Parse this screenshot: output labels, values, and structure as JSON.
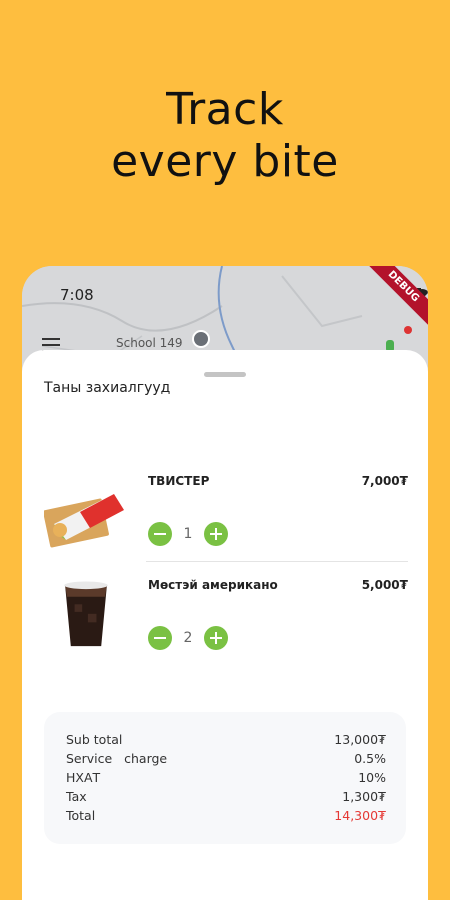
{
  "headline": {
    "line1": "Track",
    "line2": "every bite"
  },
  "status_bar": {
    "time": "7:08",
    "debug_label": "DEBUG"
  },
  "map": {
    "place_label": "School 149"
  },
  "sheet": {
    "title": "Таны захиалгууд"
  },
  "items": [
    {
      "name": "ТВИСТЕР",
      "price": "7,000₮",
      "quantity": "1",
      "icon": "twister-wrap-image"
    },
    {
      "name": "Мөстэй американо",
      "price": "5,000₮",
      "quantity": "2",
      "icon": "iced-americano-image"
    }
  ],
  "summary": {
    "sub_total_label": "Sub total",
    "sub_total_value": "13,000₮",
    "service_label": "Service   charge",
    "service_value": "0.5%",
    "nhat_label": "НХАТ",
    "nhat_value": "10%",
    "tax_label": "Tax",
    "tax_value": "1,300₮",
    "total_label": "Total",
    "total_value": "14,300₮"
  },
  "colors": {
    "background": "#FEBE3F",
    "accent_green": "#7AC143",
    "total_red": "#E53935"
  }
}
